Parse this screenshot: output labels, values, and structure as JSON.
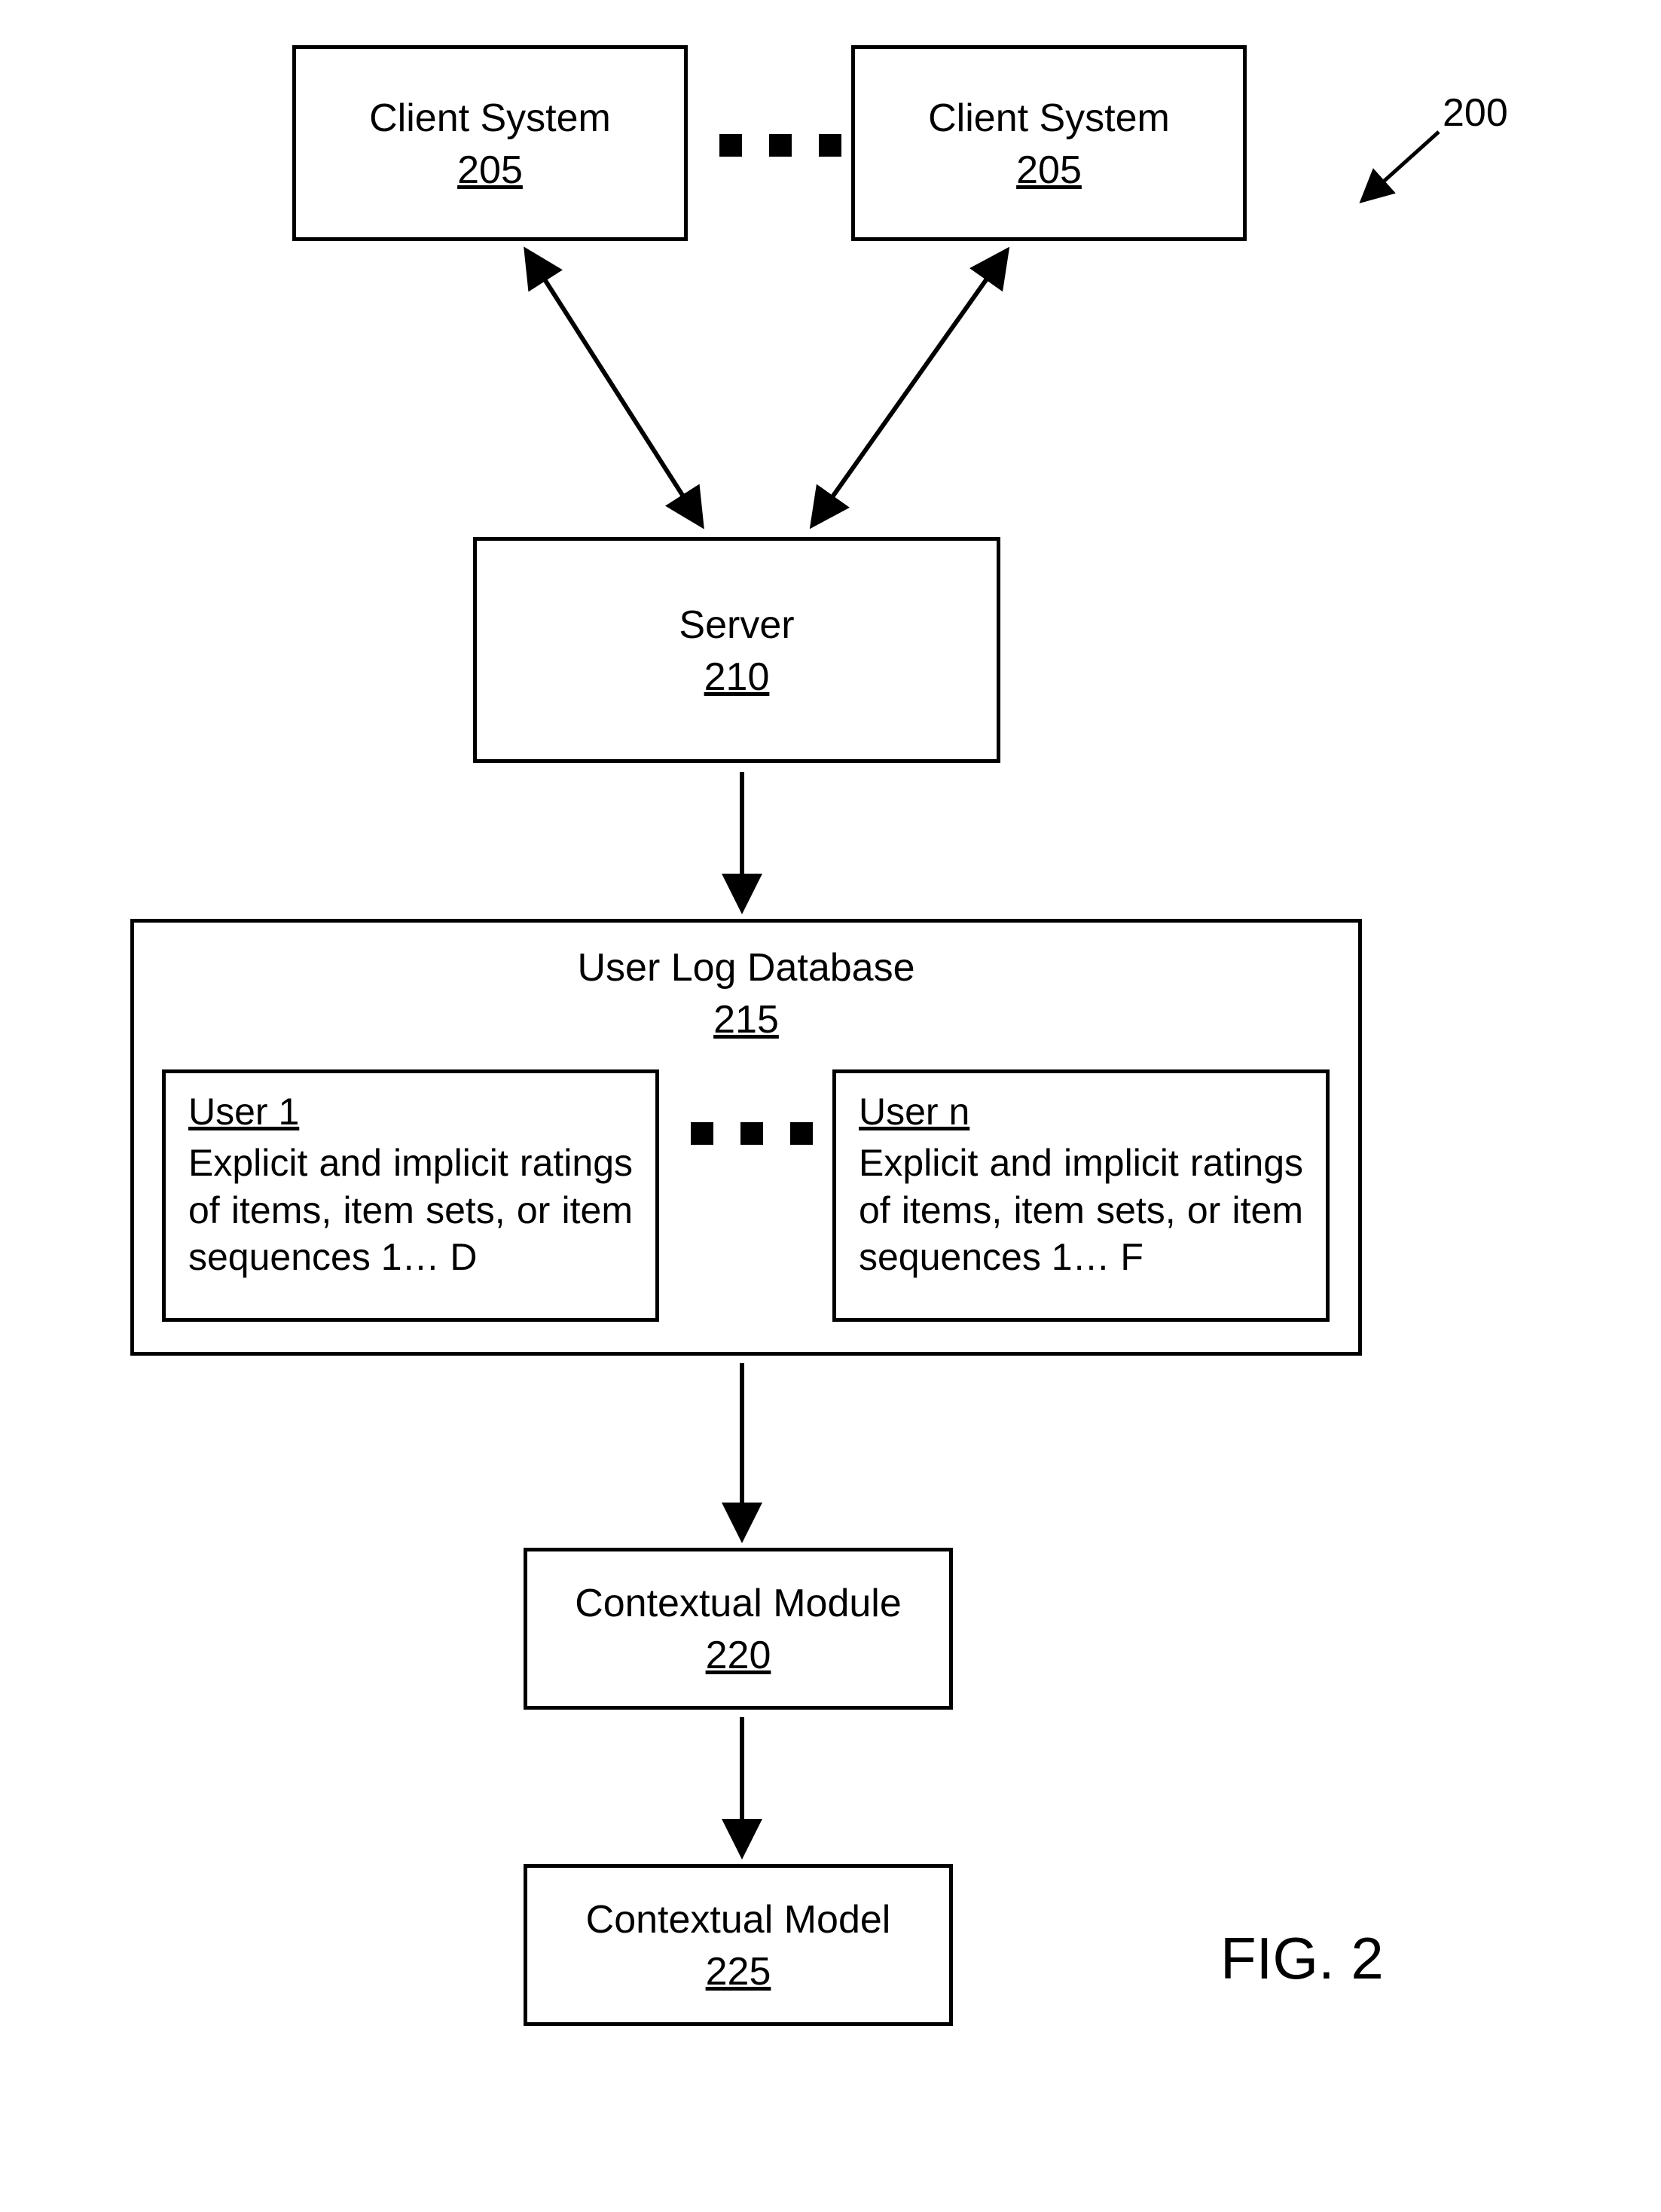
{
  "ref": {
    "figure": "200"
  },
  "clientA": {
    "title": "Client System",
    "num": "205"
  },
  "clientB": {
    "title": "Client System",
    "num": "205"
  },
  "server": {
    "title": "Server",
    "num": "210"
  },
  "db": {
    "title": "User Log Database",
    "num": "215",
    "user1": {
      "title": "User 1",
      "body": "Explicit and implicit ratings of items, item sets, or item sequences 1… D"
    },
    "usern": {
      "title": "User n",
      "body": "Explicit and implicit ratings of items, item sets, or item sequences 1… F"
    }
  },
  "module": {
    "title": "Contextual Module",
    "num": "220"
  },
  "model": {
    "title": "Contextual Model",
    "num": "225"
  },
  "figlabel": "FIG. 2"
}
